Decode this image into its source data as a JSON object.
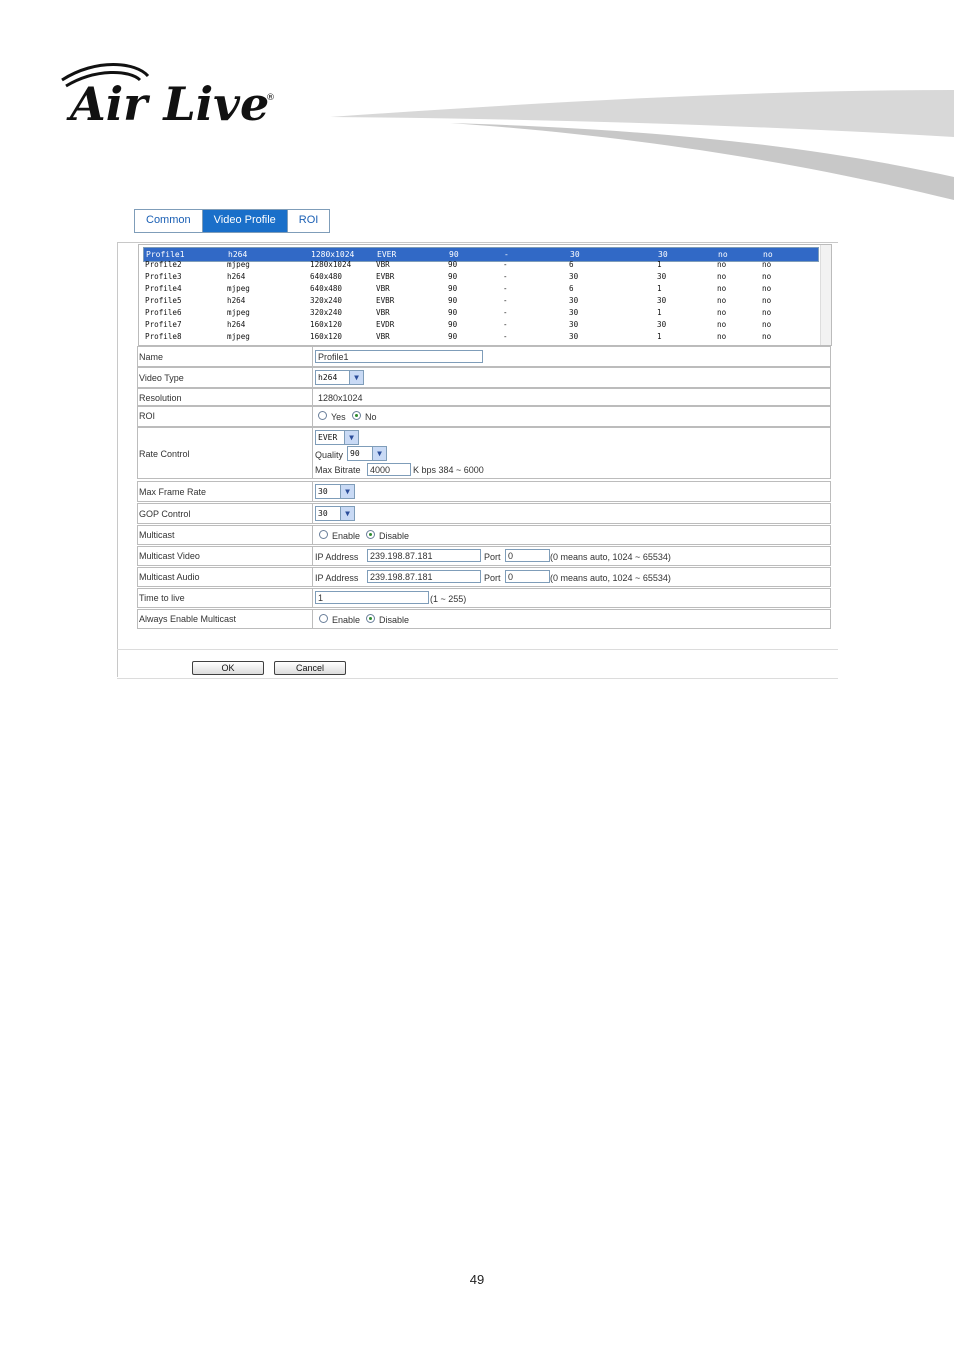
{
  "brand": {
    "logo_text": "Air Live",
    "registered": "®"
  },
  "tabs": [
    {
      "label": "Common"
    },
    {
      "label": "Video Profile"
    },
    {
      "label": "ROI"
    }
  ],
  "profiles": [
    [
      "Profile1",
      "h264",
      "1280x1024",
      "EVER",
      "90",
      "-",
      "30",
      "30",
      "no",
      "no"
    ],
    [
      "Profile2",
      "mjpeg",
      "1280x1024",
      "VBR",
      "90",
      "-",
      "6",
      "1",
      "no",
      "no"
    ],
    [
      "Profile3",
      "h264",
      "640x480",
      "EVBR",
      "90",
      "-",
      "30",
      "30",
      "no",
      "no"
    ],
    [
      "Profile4",
      "mjpeg",
      "640x480",
      "VBR",
      "90",
      "-",
      "6",
      "1",
      "no",
      "no"
    ],
    [
      "Profile5",
      "h264",
      "320x240",
      "EVBR",
      "90",
      "-",
      "30",
      "30",
      "no",
      "no"
    ],
    [
      "Profile6",
      "mjpeg",
      "320x240",
      "VBR",
      "90",
      "-",
      "30",
      "1",
      "no",
      "no"
    ],
    [
      "Profile7",
      "h264",
      "160x120",
      "EVDR",
      "90",
      "-",
      "30",
      "30",
      "no",
      "no"
    ],
    [
      "Profile8",
      "mjpeg",
      "160x120",
      "VBR",
      "90",
      "-",
      "30",
      "1",
      "no",
      "no"
    ]
  ],
  "form": {
    "name": {
      "label": "Name",
      "value": "Profile1"
    },
    "video_type": {
      "label": "Video Type",
      "value": "h264"
    },
    "resolution": {
      "label": "Resolution",
      "value": "1280x1024"
    },
    "roi": {
      "label": "ROI",
      "yes": "Yes",
      "no": "No"
    },
    "rate_control": {
      "label": "Rate Control",
      "mode": "EVER",
      "quality_label": "Quality",
      "quality": "90",
      "max_bitrate_label": "Max Bitrate",
      "max_bitrate": "4000",
      "max_bitrate_hint": "K bps 384 ~ 6000"
    },
    "max_frame_rate": {
      "label": "Max Frame Rate",
      "value": "30"
    },
    "gop_control": {
      "label": "GOP Control",
      "value": "30"
    },
    "multicast": {
      "label": "Multicast",
      "enable": "Enable",
      "disable": "Disable"
    },
    "multicast_video": {
      "label": "Multicast Video",
      "ip_label": "IP Address",
      "ip": "239.198.87.181",
      "port_label": "Port",
      "port": "0",
      "hint": "(0 means auto, 1024 ~ 65534)"
    },
    "multicast_audio": {
      "label": "Multicast Audio",
      "ip_label": "IP Address",
      "ip": "239.198.87.181",
      "port_label": "Port",
      "port": "0",
      "hint": "(0 means auto, 1024 ~ 65534)"
    },
    "ttl": {
      "label": "Time to live",
      "value": "1",
      "hint": "(1 ~ 255)"
    },
    "always_multicast": {
      "label": "Always Enable Multicast",
      "enable": "Enable",
      "disable": "Disable"
    }
  },
  "buttons": {
    "ok": "OK",
    "cancel": "Cancel"
  },
  "page_number": "49",
  "colors": {
    "selected_row": "#3169c6",
    "tab_active": "#1a6fc9",
    "radio_on": "#2e8b2e"
  }
}
